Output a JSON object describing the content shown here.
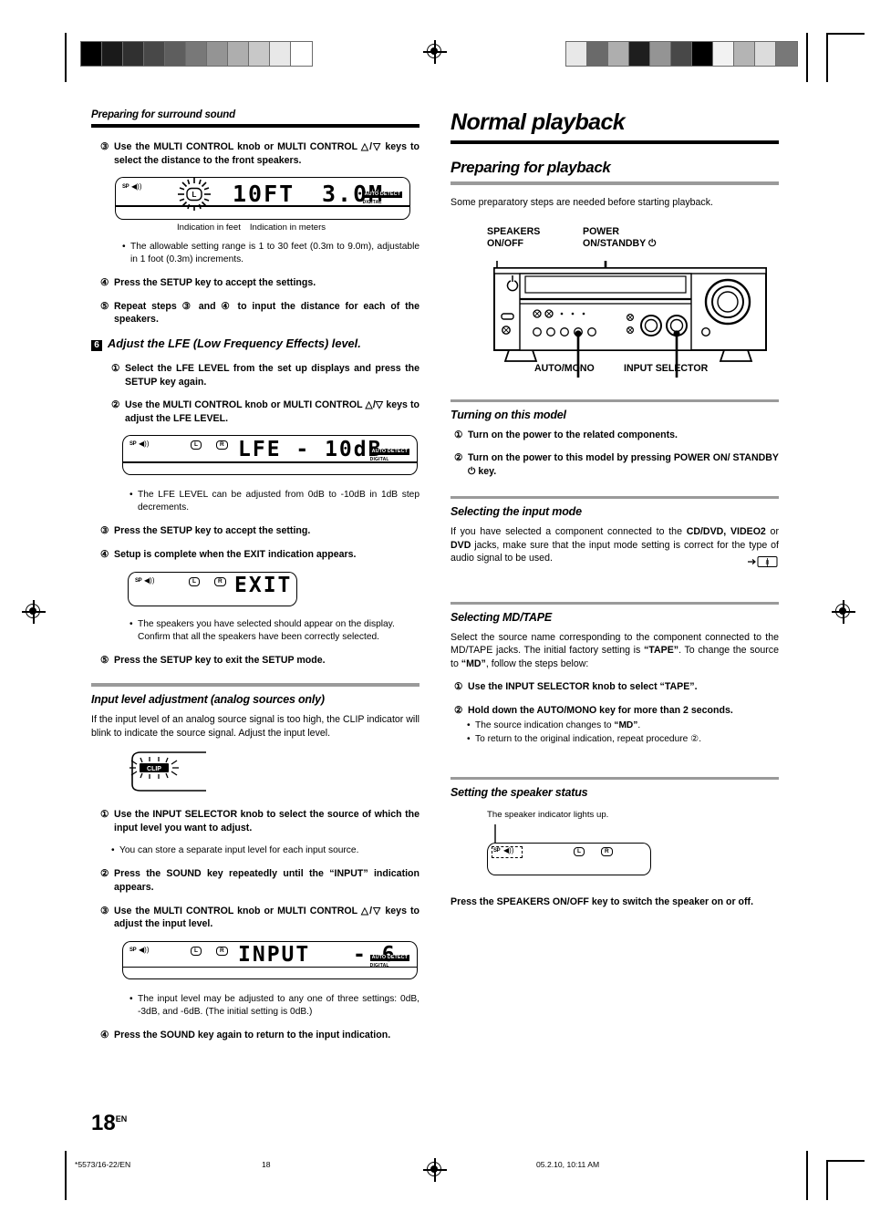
{
  "page": {
    "number": "18",
    "lang_suffix": "EN",
    "footer_left": "*5573/16-22/EN",
    "footer_center": "18",
    "footer_right": "05.2.10, 10:11 AM"
  },
  "left_column": {
    "running_head": "Preparing for surround sound",
    "step3": {
      "num": "③",
      "text": "Use the MULTI CONTROL knob or MULTI CONTROL △/▽ keys to select the distance to the front speakers."
    },
    "display_distance": {
      "speaker_label": "SP",
      "left_label": "L",
      "segment_feet": "10FT",
      "segment_meters": "3.0M",
      "badge_top": "AUTO DETECT",
      "badge_bottom": "DIGITAL"
    },
    "display_distance_captions": {
      "feet": "Indication in feet",
      "meters": "Indication in meters"
    },
    "bullet_range": "The allowable setting range is 1 to 30 feet (0.3m to 9.0m), adjustable in 1 foot (0.3m) increments.",
    "step4": {
      "num": "④",
      "text": "Press the SETUP key to accept the settings."
    },
    "step5": {
      "num": "⑤",
      "text_a": "Repeat steps",
      "n1": "③",
      "text_b": "and",
      "n2": "④",
      "text_c": "to input the distance for each of the speakers."
    },
    "bigstep6": {
      "num": "6",
      "text": "Adjust the LFE (Low Frequency Effects) level."
    },
    "lfe_step1": {
      "num": "①",
      "text": "Select the LFE LEVEL from the set up displays and press the SETUP key again."
    },
    "lfe_step2": {
      "num": "②",
      "text": "Use the MULTI CONTROL knob or MULTI CONTROL △/▽ keys to adjust the LFE LEVEL."
    },
    "display_lfe": {
      "speaker_label": "SP",
      "left_label": "L",
      "right_label": "R",
      "segment": "LFE - 10dB",
      "badge_top": "AUTO DETECT",
      "badge_bottom": "DIGITAL"
    },
    "bullet_lfe": "The LFE LEVEL can be adjusted from 0dB to -10dB in 1dB step decrements.",
    "lfe_step3": {
      "num": "③",
      "text": "Press the SETUP key to accept the setting."
    },
    "lfe_step4": {
      "num": "④",
      "text": "Setup is complete when the EXIT indication appears."
    },
    "display_exit": {
      "speaker_label": "SP",
      "left_label": "L",
      "right_label": "R",
      "segment": "EXIT"
    },
    "bullet_exit": "The speakers you have selected should appear on the display. Confirm that all the speakers have been correctly selected.",
    "lfe_step5": {
      "num": "⑤",
      "text": "Press the SETUP key to exit the SETUP mode."
    },
    "input_level": {
      "heading": "Input level adjustment (analog sources only)",
      "intro": "If the input level of an analog source signal is too high, the CLIP indicator will blink to indicate the source signal. Adjust the input level.",
      "clip_label": "CLIP",
      "step1": {
        "num": "①",
        "text": "Use the INPUT SELECTOR knob to select the source of which the input level you want to adjust."
      },
      "bullet1": "You can store a separate input level for each input source.",
      "step2": {
        "num": "②",
        "text": "Press the SOUND key repeatedly until the “INPUT” indication appears."
      },
      "step3": {
        "num": "③",
        "text": "Use the MULTI CONTROL knob or MULTI CONTROL △/▽ keys to adjust the input level."
      },
      "display_input": {
        "speaker_label": "SP",
        "left_label": "L",
        "right_label": "R",
        "segment_name": "INPUT",
        "segment_value": "- 6",
        "badge_top": "AUTO DETECT",
        "badge_bottom": "DIGITAL"
      },
      "bullet2": "The input level may be adjusted to any one of three settings: 0dB, -3dB, and -6dB. (The initial setting is 0dB.)",
      "step4": {
        "num": "④",
        "text": "Press the SOUND key again to return to the input indication."
      }
    }
  },
  "right_column": {
    "chapter_title": "Normal playback",
    "section_title": "Preparing for playback",
    "intro": "Some preparatory steps are needed before starting playback.",
    "diagram_labels": {
      "speakers_on_off": "SPEAKERS\nON/OFF",
      "power_standby": "POWER\nON/STANDBY ⏻",
      "auto_mono": "AUTO/MONO",
      "input_selector": "INPUT SELECTOR"
    },
    "turning_on": {
      "heading": "Turning on this model",
      "step1": {
        "num": "①",
        "text": "Turn on the power to the related components."
      },
      "step2": {
        "num": "②",
        "text": "Turn on the power to this model by pressing POWER ON/ STANDBY ⏻ key."
      }
    },
    "input_mode": {
      "heading": "Selecting the input mode",
      "text_a": "If you have selected a component connected to the ",
      "bold_a": "CD/DVD, VIDEO2",
      "text_b": " or ",
      "bold_b": "DVD",
      "text_c": " jacks, make sure that the input mode setting is correct for the type of audio signal to be used.",
      "page_ref": "8"
    },
    "md_tape": {
      "heading": "Selecting MD/TAPE",
      "text_a": "Select the source name corresponding to the component connected to the MD/TAPE jacks. The initial factory setting is ",
      "bold_a": "“TAPE”",
      "text_b": ". To change the source to ",
      "bold_b": "“MD”",
      "text_c": ", follow the steps below:",
      "step1": {
        "num": "①",
        "text": "Use the INPUT SELECTOR knob to select “TAPE”."
      },
      "step2": {
        "num": "②",
        "text": "Hold down the AUTO/MONO key for more than 2 seconds."
      },
      "bullet1_a": "The source indication changes to ",
      "bullet1_b": "“MD”",
      "bullet1_c": ".",
      "bullet2_a": "To return to the original indication, repeat procedure ",
      "bullet2_num": "②",
      "bullet2_c": "."
    },
    "speaker_status": {
      "heading": "Setting the speaker status",
      "caption": "The speaker indicator lights up.",
      "display": {
        "speaker_label": "SP",
        "left_label": "L",
        "right_label": "R"
      },
      "closing": "Press the SPEAKERS ON/OFF key to switch the speaker on or off."
    }
  },
  "gray_strip_left": [
    "#000000",
    "#1a1a1a",
    "#303030",
    "#484848",
    "#5e5e5e",
    "#787878",
    "#949494",
    "#aeaeae",
    "#c8c8c8",
    "#e8e8e8",
    "#ffffff"
  ],
  "gray_strip_right": [
    "#e8e8e8",
    "#6a6a6a",
    "#aeaeae",
    "#1e1e1e",
    "#949494",
    "#484848",
    "#000000",
    "#f2f2f2",
    "#b4b4b4",
    "#dcdcdc",
    "#787878"
  ]
}
